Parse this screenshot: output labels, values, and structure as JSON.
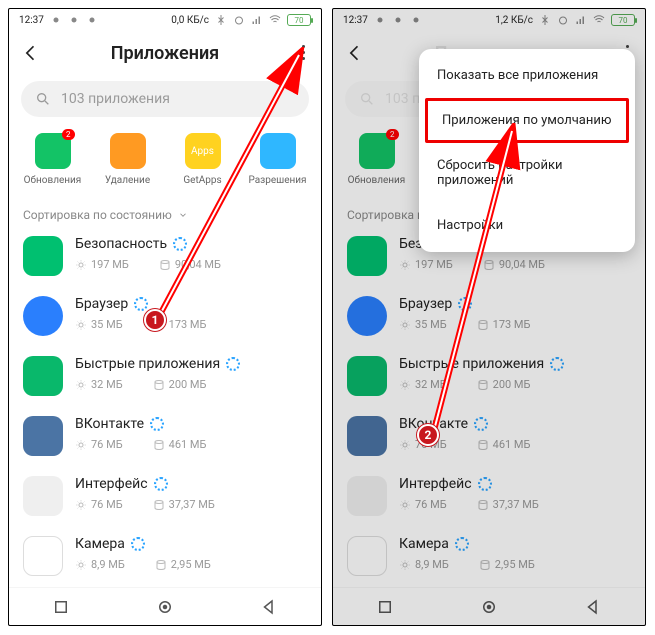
{
  "status": {
    "time": "12:37",
    "net_left": "0,0 КБ/с",
    "net_right": "1,2 КБ/с",
    "battery": "70"
  },
  "header": {
    "title": "Приложения"
  },
  "search": {
    "placeholder": "103 приложения"
  },
  "quick": [
    {
      "label": "Обновления",
      "color": "green",
      "badge": "2"
    },
    {
      "label": "Удаление",
      "color": "orange"
    },
    {
      "label": "GetApps",
      "color": "yellow",
      "tag": "Apps"
    },
    {
      "label": "Разрешения",
      "color": "blue"
    }
  ],
  "sort_label": "Сортировка по состоянию",
  "apps": [
    {
      "name": "Безопасность",
      "icon": "sec",
      "mem": "197 МБ",
      "disk": "90,04 МБ"
    },
    {
      "name": "Браузер",
      "icon": "brw",
      "mem": "35 МБ",
      "disk": "173 МБ"
    },
    {
      "name": "Быстрые приложения",
      "icon": "fast",
      "mem": "32 МБ",
      "disk": "200 МБ"
    },
    {
      "name": "ВКонтакте",
      "icon": "vk",
      "mem": "76 МБ",
      "disk": "461 МБ"
    },
    {
      "name": "Интерфейс",
      "icon": "ifc",
      "mem": "76 МБ",
      "disk": "37,37 МБ"
    },
    {
      "name": "Камера",
      "icon": "cam",
      "mem": "8,9 МБ",
      "disk": "2,95 МБ"
    }
  ],
  "menu": {
    "show_all": "Показать все приложения",
    "default_apps": "Приложения по умолчанию",
    "reset": "Сбросить настройки приложений",
    "settings": "Настройки"
  },
  "markers": {
    "one": "1",
    "two": "2"
  }
}
